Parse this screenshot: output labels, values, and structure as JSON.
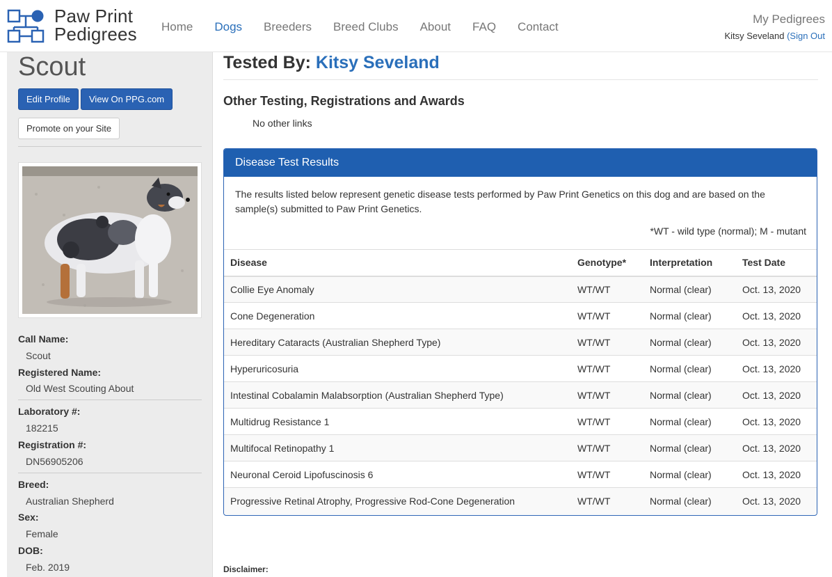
{
  "brand": {
    "line1": "Paw Print",
    "line2": "Pedigrees"
  },
  "nav": [
    {
      "label": "Home",
      "active": false
    },
    {
      "label": "Dogs",
      "active": true
    },
    {
      "label": "Breeders",
      "active": false
    },
    {
      "label": "Breed Clubs",
      "active": false
    },
    {
      "label": "About",
      "active": false
    },
    {
      "label": "FAQ",
      "active": false
    },
    {
      "label": "Contact",
      "active": false
    }
  ],
  "user": {
    "my_pedigrees": "My Pedigrees",
    "name": "Kitsy Seveland",
    "signout": "(Sign Out"
  },
  "sidebar": {
    "dog_name": "Scout",
    "edit_label": "Edit Profile",
    "view_label": "View On PPG.com",
    "promote_label": "Promote on your Site",
    "fields": {
      "call_name_label": "Call Name:",
      "call_name": "Scout",
      "reg_name_label": "Registered Name:",
      "reg_name": "Old West Scouting About",
      "lab_label": "Laboratory #:",
      "lab": "182215",
      "reg_no_label": "Registration #:",
      "reg_no": "DN56905206",
      "breed_label": "Breed:",
      "breed": "Australian Shepherd",
      "sex_label": "Sex:",
      "sex": "Female",
      "dob_label": "DOB:",
      "dob": "Feb. 2019"
    }
  },
  "main": {
    "tested_by_label": "Tested By:",
    "tested_by_name": "Kitsy Seveland",
    "other_heading": "Other Testing, Registrations and Awards",
    "no_links": "No other links",
    "panel_title": "Disease Test Results",
    "panel_text": "The results listed below represent genetic disease tests performed by Paw Print Genetics on this dog and are based on the sample(s) submitted to Paw Print Genetics.",
    "note": "*WT - wild type (normal); M - mutant",
    "columns": [
      "Disease",
      "Genotype*",
      "Interpretation",
      "Test Date"
    ],
    "rows": [
      [
        "Collie Eye Anomaly",
        "WT/WT",
        "Normal (clear)",
        "Oct. 13, 2020"
      ],
      [
        "Cone Degeneration",
        "WT/WT",
        "Normal (clear)",
        "Oct. 13, 2020"
      ],
      [
        "Hereditary Cataracts (Australian Shepherd Type)",
        "WT/WT",
        "Normal (clear)",
        "Oct. 13, 2020"
      ],
      [
        "Hyperuricosuria",
        "WT/WT",
        "Normal (clear)",
        "Oct. 13, 2020"
      ],
      [
        "Intestinal Cobalamin Malabsorption (Australian Shepherd Type)",
        "WT/WT",
        "Normal (clear)",
        "Oct. 13, 2020"
      ],
      [
        "Multidrug Resistance 1",
        "WT/WT",
        "Normal (clear)",
        "Oct. 13, 2020"
      ],
      [
        "Multifocal Retinopathy 1",
        "WT/WT",
        "Normal (clear)",
        "Oct. 13, 2020"
      ],
      [
        "Neuronal Ceroid Lipofuscinosis 6",
        "WT/WT",
        "Normal (clear)",
        "Oct. 13, 2020"
      ],
      [
        "Progressive Retinal Atrophy, Progressive Rod-Cone Degeneration",
        "WT/WT",
        "Normal (clear)",
        "Oct. 13, 2020"
      ]
    ],
    "disclaimer": "Disclaimer:"
  },
  "colors": {
    "accent": "#2a6fba",
    "panel_header": "#1f5fb0",
    "button": "#2a62b3"
  }
}
